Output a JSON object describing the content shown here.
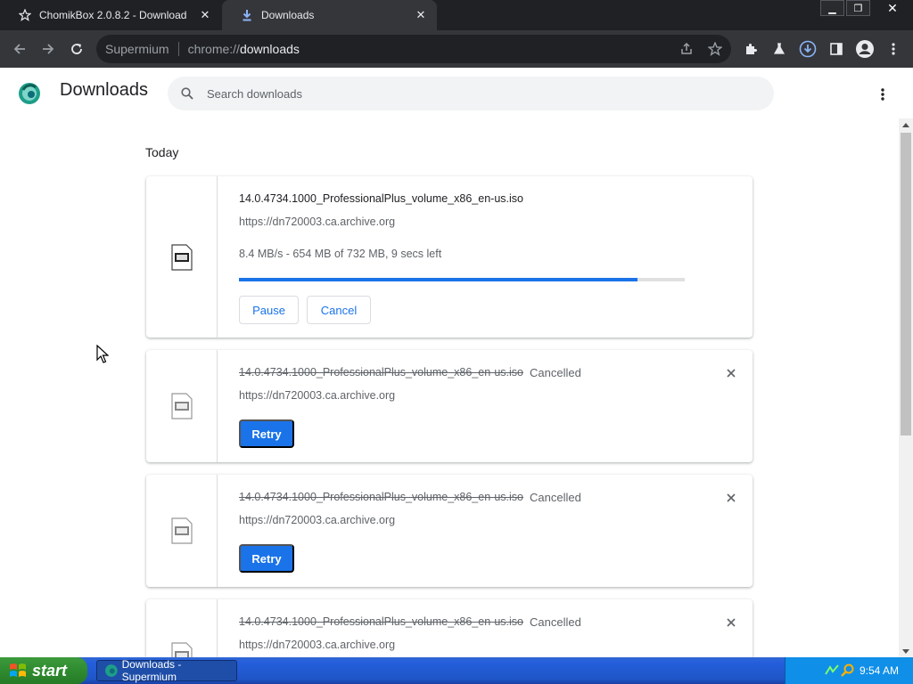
{
  "browser": {
    "tabs": [
      {
        "title": "ChomikBox 2.0.8.2 - Download",
        "active": false
      },
      {
        "title": "Downloads",
        "active": true
      }
    ],
    "omnibox": {
      "chip": "Supermium",
      "scheme": "chrome://",
      "host": "downloads"
    }
  },
  "page": {
    "title": "Downloads",
    "search_placeholder": "Search downloads",
    "section": "Today",
    "items": [
      {
        "filename": "14.0.4734.1000_ProfessionalPlus_volume_x86_en-us.iso",
        "url": "https://dn720003.ca.archive.org",
        "progress_text": "8.4 MB/s - 654 MB of 732 MB, 9 secs left",
        "progress": 0.893,
        "pause_label": "Pause",
        "cancel_label": "Cancel"
      },
      {
        "filename": "14.0.4734.1000_ProfessionalPlus_volume_x86_en-us.iso",
        "status": "Cancelled",
        "url": "https://dn720003.ca.archive.org",
        "retry_label": "Retry"
      },
      {
        "filename": "14.0.4734.1000_ProfessionalPlus_volume_x86_en-us.iso",
        "status": "Cancelled",
        "url": "https://dn720003.ca.archive.org",
        "retry_label": "Retry"
      },
      {
        "filename": "14.0.4734.1000_ProfessionalPlus_volume_x86_en-us.iso",
        "status": "Cancelled",
        "url": "https://dn720003.ca.archive.org"
      }
    ]
  },
  "taskbar": {
    "start_label": "start",
    "task": "Downloads - Supermium",
    "clock": "9:54 AM"
  },
  "colors": {
    "accent": "#1a73e8",
    "chrome_dark": "#202124",
    "toolbar": "#35363a"
  }
}
